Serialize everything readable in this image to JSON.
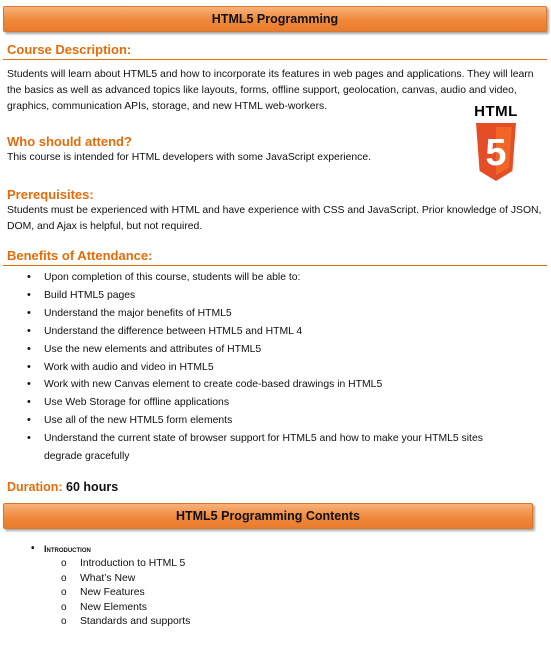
{
  "header": {
    "title": "HTML5 Programming"
  },
  "course_description": {
    "heading": "Course Description:",
    "text": "Students will learn about HTML5 and how to incorporate its features in web pages and applications. They will learn the basics as well as advanced topics like layouts, forms, offline support, geolocation, canvas, audio and video, graphics, communication APIs, storage, and new HTML web-workers."
  },
  "logo": {
    "word": "HTML",
    "digit": "5",
    "colors": {
      "shield_dark": "#e44d26",
      "shield_light": "#f16529",
      "digit": "#ffffff"
    }
  },
  "audience": {
    "heading": "Who should attend?",
    "text": "This course is intended for HTML developers with some JavaScript experience."
  },
  "prerequisites": {
    "heading": "Prerequisites:",
    "text": "Students must be experienced with HTML and have experience with CSS and JavaScript. Prior knowledge of JSON, DOM, and Ajax is helpful, but not required."
  },
  "benefits": {
    "heading": "Benefits of Attendance:",
    "items": [
      "Upon completion of this course, students will be able to:",
      "Build HTML5 pages",
      "Understand the major benefits of HTML5",
      "Understand the difference between HTML5 and HTML 4",
      "Use the new elements and attributes of HTML5",
      "Work with audio and video in HTML5",
      "Work with new Canvas element to create code-based drawings in HTML5",
      "Use Web Storage for offline applications",
      "Use all of the new HTML5 form elements",
      "Understand the current state of browser support for HTML5 and how to make your HTML5 sites degrade gracefully"
    ]
  },
  "duration": {
    "label": "Duration:",
    "value": "60 hours"
  },
  "contents": {
    "title": "HTML5 Programming Contents",
    "section": "Introduction",
    "items": [
      "Introduction to HTML 5",
      "What’s New",
      "New Features",
      "New Elements",
      "Standards and supports"
    ]
  },
  "colors": {
    "accent": "#e46c0a",
    "banner": "#f0883a"
  }
}
